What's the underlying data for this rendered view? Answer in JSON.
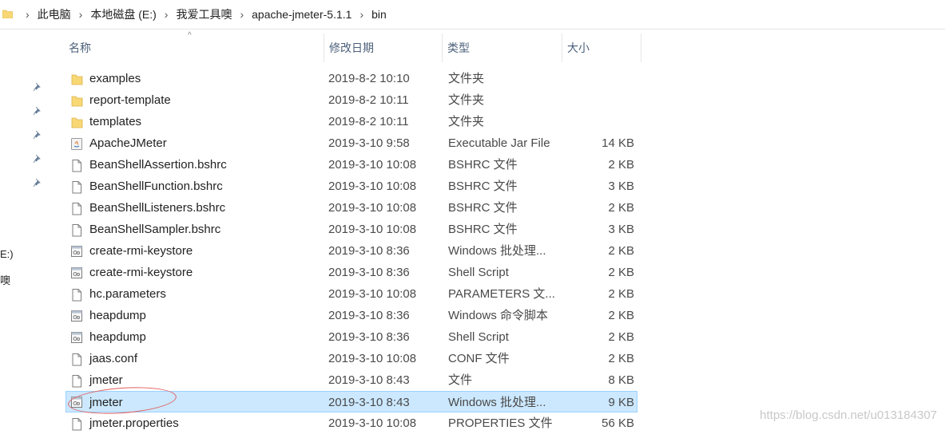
{
  "breadcrumb": [
    "此电脑",
    "本地磁盘 (E:)",
    "我爱工具噢",
    "apache-jmeter-5.1.1",
    "bin"
  ],
  "nav": {
    "drive_fragment": "E:)",
    "folder_fragment": "噢"
  },
  "columns": {
    "name": "名称",
    "date": "修改日期",
    "type": "类型",
    "size": "大小"
  },
  "files": [
    {
      "name": "examples",
      "date": "2019-8-2 10:10",
      "type": "文件夹",
      "size": "",
      "icon": "folder-icon"
    },
    {
      "name": "report-template",
      "date": "2019-8-2 10:11",
      "type": "文件夹",
      "size": "",
      "icon": "folder-icon"
    },
    {
      "name": "templates",
      "date": "2019-8-2 10:11",
      "type": "文件夹",
      "size": "",
      "icon": "folder-icon"
    },
    {
      "name": "ApacheJMeter",
      "date": "2019-3-10 9:58",
      "type": "Executable Jar File",
      "size": "14 KB",
      "icon": "java-jar-icon"
    },
    {
      "name": "BeanShellAssertion.bshrc",
      "date": "2019-3-10 10:08",
      "type": "BSHRC 文件",
      "size": "2 KB",
      "icon": "file-icon"
    },
    {
      "name": "BeanShellFunction.bshrc",
      "date": "2019-3-10 10:08",
      "type": "BSHRC 文件",
      "size": "3 KB",
      "icon": "file-icon"
    },
    {
      "name": "BeanShellListeners.bshrc",
      "date": "2019-3-10 10:08",
      "type": "BSHRC 文件",
      "size": "2 KB",
      "icon": "file-icon"
    },
    {
      "name": "BeanShellSampler.bshrc",
      "date": "2019-3-10 10:08",
      "type": "BSHRC 文件",
      "size": "3 KB",
      "icon": "file-icon"
    },
    {
      "name": "create-rmi-keystore",
      "date": "2019-3-10 8:36",
      "type": "Windows 批处理...",
      "size": "2 KB",
      "icon": "script-icon"
    },
    {
      "name": "create-rmi-keystore",
      "date": "2019-3-10 8:36",
      "type": "Shell Script",
      "size": "2 KB",
      "icon": "script-icon"
    },
    {
      "name": "hc.parameters",
      "date": "2019-3-10 10:08",
      "type": "PARAMETERS 文...",
      "size": "2 KB",
      "icon": "file-icon"
    },
    {
      "name": "heapdump",
      "date": "2019-3-10 8:36",
      "type": "Windows 命令脚本",
      "size": "2 KB",
      "icon": "script-icon"
    },
    {
      "name": "heapdump",
      "date": "2019-3-10 8:36",
      "type": "Shell Script",
      "size": "2 KB",
      "icon": "script-icon"
    },
    {
      "name": "jaas.conf",
      "date": "2019-3-10 10:08",
      "type": "CONF 文件",
      "size": "2 KB",
      "icon": "file-icon"
    },
    {
      "name": "jmeter",
      "date": "2019-3-10 8:43",
      "type": "文件",
      "size": "8 KB",
      "icon": "file-icon"
    },
    {
      "name": "jmeter",
      "date": "2019-3-10 8:43",
      "type": "Windows 批处理...",
      "size": "9 KB",
      "icon": "script-icon",
      "selected": true
    },
    {
      "name": "jmeter.properties",
      "date": "2019-3-10 10:08",
      "type": "PROPERTIES 文件",
      "size": "56 KB",
      "icon": "file-icon"
    }
  ],
  "watermark": "https://blog.csdn.net/u013184307",
  "colors": {
    "selection": "#cce8ff",
    "selection_border": "#99d1ff",
    "folder": "#f8d775",
    "annotation": "#e06060"
  }
}
